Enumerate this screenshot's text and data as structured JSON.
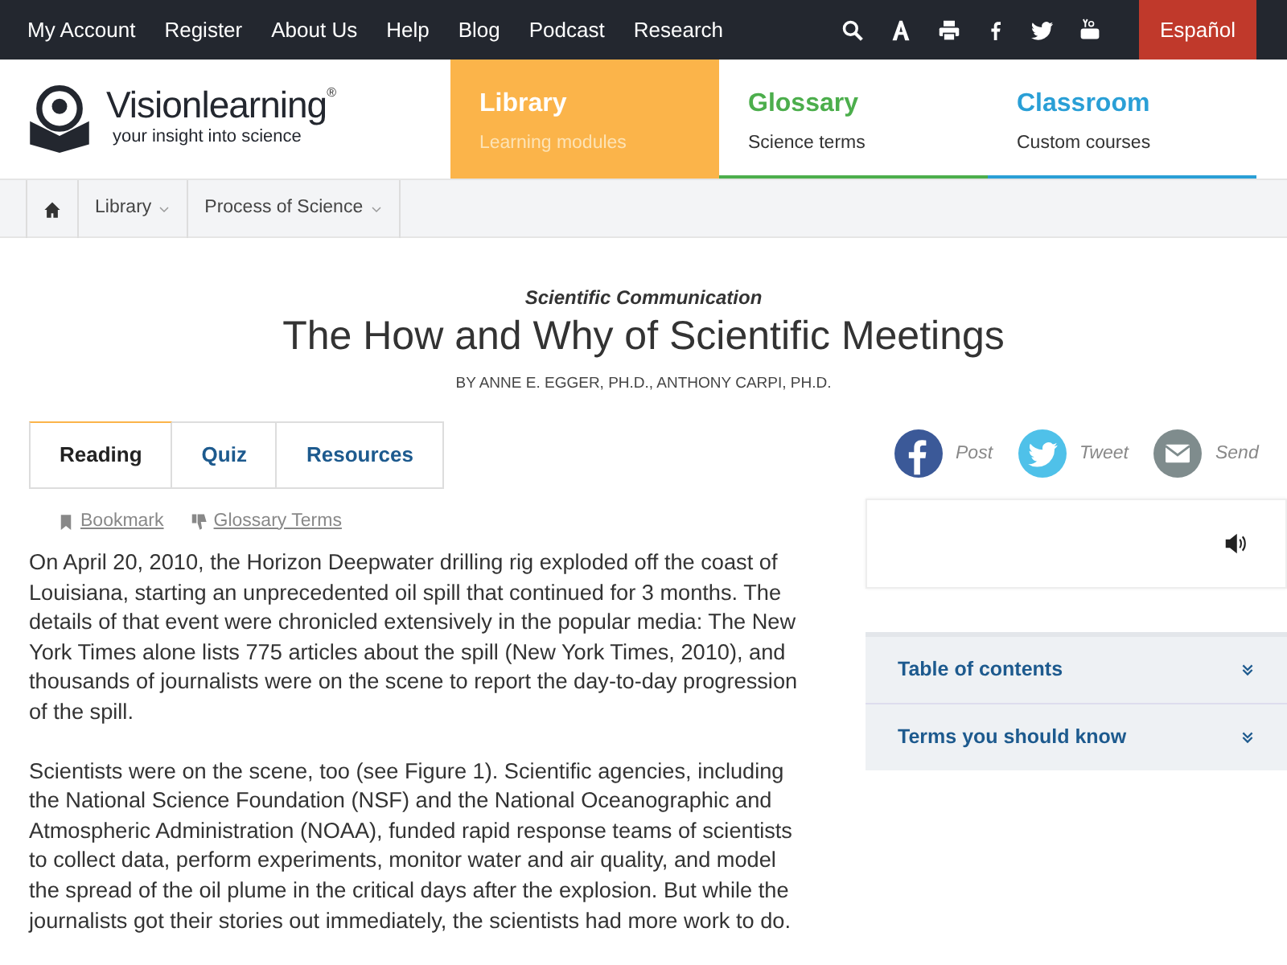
{
  "top_nav": {
    "links": [
      "My Account",
      "Register",
      "About Us",
      "Help",
      "Blog",
      "Podcast",
      "Research"
    ],
    "language_button": "Español"
  },
  "logo": {
    "name": "Visionlearning",
    "registered": "®",
    "tagline": "your insight into science"
  },
  "sections": [
    {
      "title": "Library",
      "subtitle": "Learning modules",
      "selected": true,
      "color": "#fbb44a"
    },
    {
      "title": "Glossary",
      "subtitle": "Science terms",
      "selected": false,
      "color": "#4cae4c"
    },
    {
      "title": "Classroom",
      "subtitle": "Custom courses",
      "selected": false,
      "color": "#2a9fd6"
    }
  ],
  "breadcrumb": [
    "Library",
    "Process of Science"
  ],
  "article": {
    "category": "Scientific Communication",
    "title": "The How and Why of Scientific Meetings",
    "byline": "BY ANNE E. EGGER, PH.D., ANTHONY CARPI, PH.D."
  },
  "tabs": [
    {
      "label": "Reading",
      "selected": true
    },
    {
      "label": "Quiz",
      "selected": false
    },
    {
      "label": "Resources",
      "selected": false
    }
  ],
  "share": [
    {
      "kind": "facebook",
      "label": "Post",
      "color": "#3b5998"
    },
    {
      "kind": "twitter",
      "label": "Tweet",
      "color": "#4fc1e9"
    },
    {
      "kind": "email",
      "label": "Send",
      "color": "#7f8c8d"
    }
  ],
  "tools": [
    "Bookmark",
    "Glossary Terms"
  ],
  "paragraphs": [
    "On April 20, 2010, the Horizon Deepwater drilling rig exploded off the coast of Louisiana, starting an unprecedented oil spill that continued for 3 months. The details of that event were chronicled extensively in the popular media: The New York Times alone lists 775 articles about the spill (New York Times, 2010), and thousands of journalists were on the scene to report the day-to-day progression of the spill.",
    "Scientists were on the scene, too (see Figure 1). Scientific agencies, including the National Science Foundation (NSF) and the National Oceanographic and Atmospheric Administration (NOAA), funded rapid response teams of scientists to collect data, perform experiments, monitor water and air quality, and model the spread of the oil plume in the critical days after the explosion. But while the journalists got their stories out immediately, the scientists had more work to do."
  ],
  "accordion": [
    {
      "label": "Table of contents",
      "expanded": false
    },
    {
      "label": "Terms you should know",
      "expanded": false
    }
  ]
}
